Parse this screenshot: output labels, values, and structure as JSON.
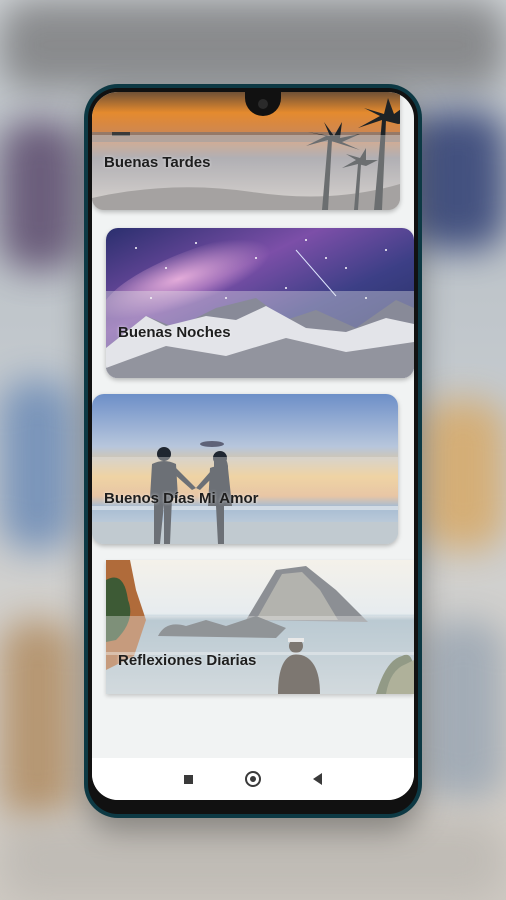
{
  "app": {
    "cards": [
      {
        "label": "Buenas Tardes",
        "image": "beach-sunset-palms"
      },
      {
        "label": "Buenas Noches",
        "image": "milky-way-mountains"
      },
      {
        "label": "Buenos Días Mi Amor",
        "image": "couple-beach-sunset"
      },
      {
        "label": "Reflexiones Diarias",
        "image": "island-sea-man"
      }
    ]
  },
  "navbar": {
    "recents_icon": "square-icon",
    "home_icon": "circle-icon",
    "back_icon": "triangle-back-icon"
  },
  "colors": {
    "phone_frame": "#0d3944",
    "screen_bg": "#f1f3f3",
    "label_text": "#1e1e1e"
  }
}
